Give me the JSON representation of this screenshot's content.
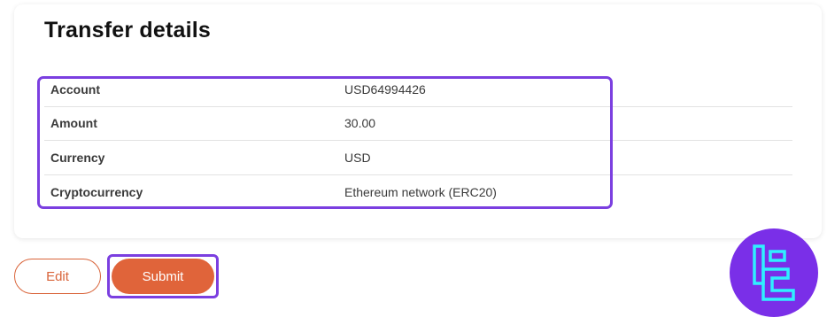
{
  "panel": {
    "title": "Transfer details",
    "rows": [
      {
        "label": "Account",
        "value": "USD64994426"
      },
      {
        "label": "Amount",
        "value": "30.00"
      },
      {
        "label": "Currency",
        "value": "USD"
      },
      {
        "label": "Cryptocurrency",
        "value": "Ethereum network (ERC20)"
      }
    ]
  },
  "actions": {
    "edit_label": "Edit",
    "submit_label": "Submit"
  },
  "colors": {
    "accent": "#e0643a",
    "highlight": "#7b3fe0",
    "logo_bg": "#7a2fe8",
    "logo_mark": "#2ff0ff"
  },
  "logo": {
    "icon": "tradingfinder-logo-icon"
  }
}
